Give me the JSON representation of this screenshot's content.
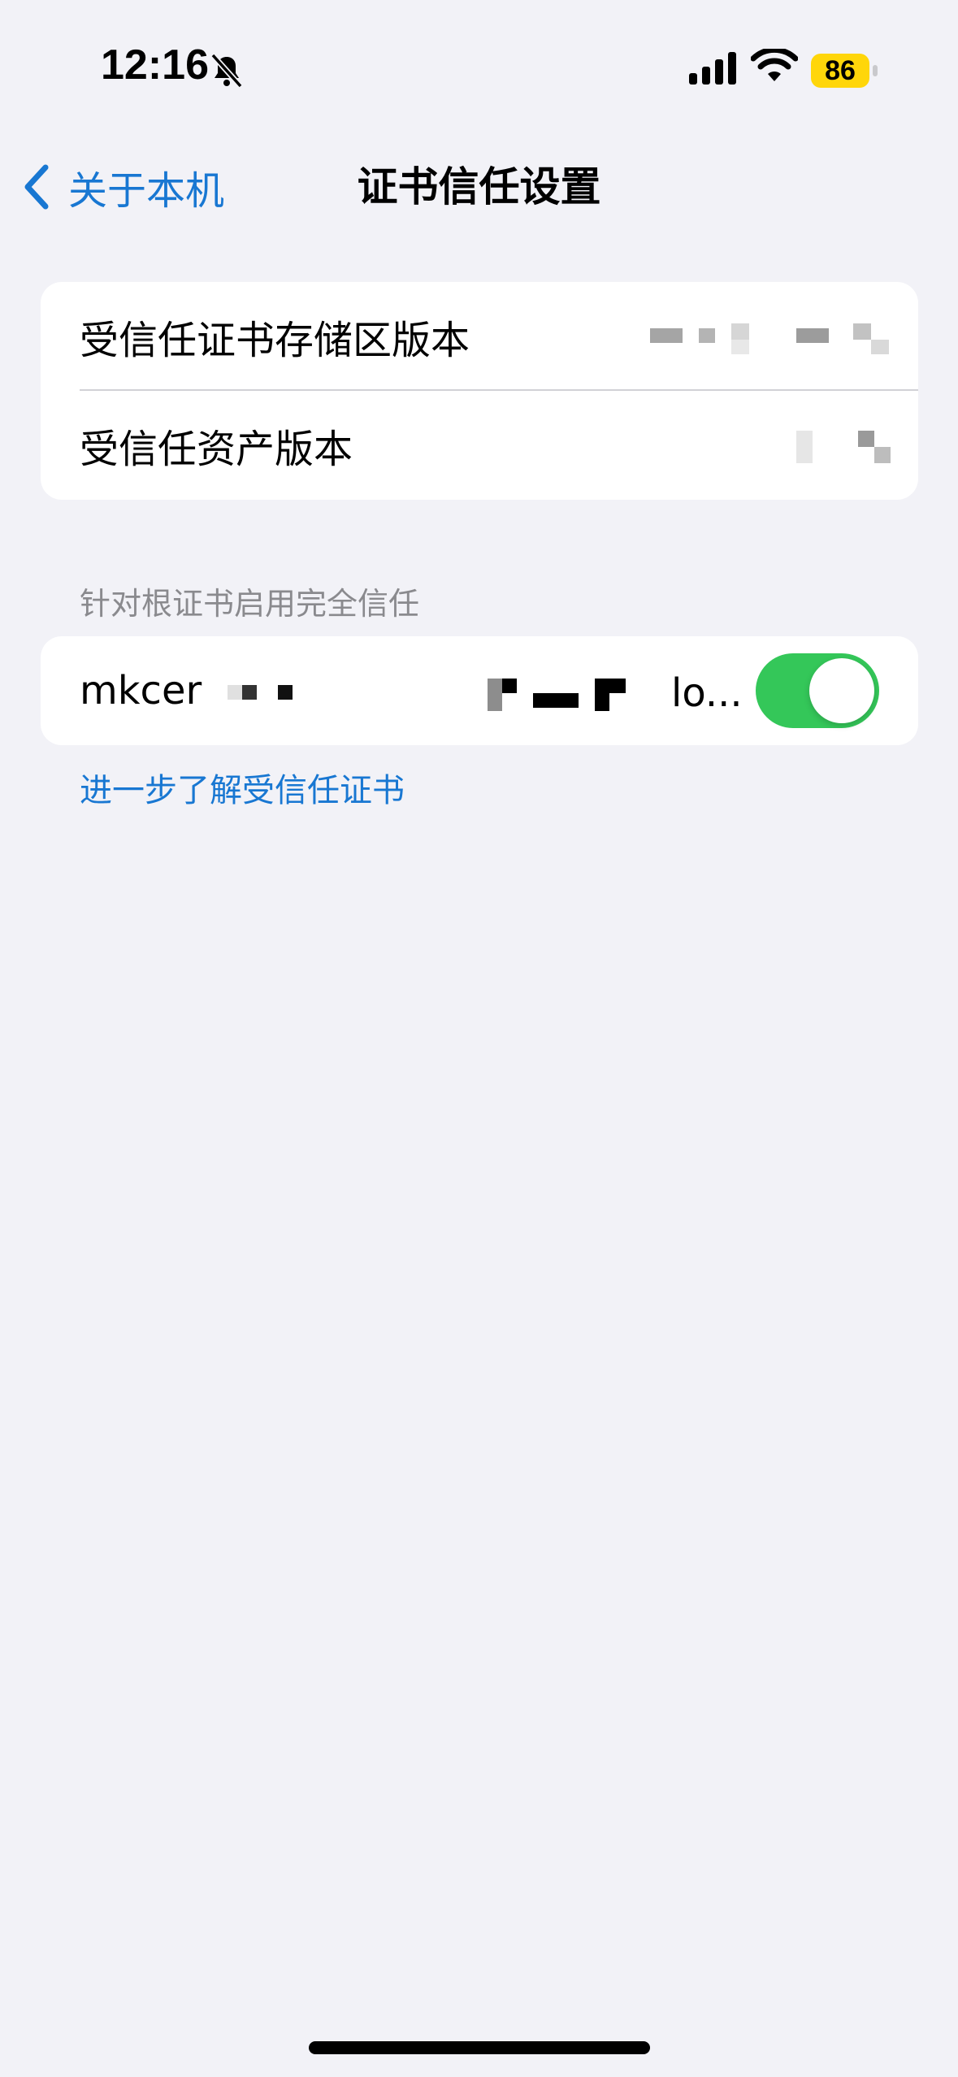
{
  "status_bar": {
    "time": "12:16",
    "battery_percent": "86",
    "battery_color": "#ffd60a",
    "icons": [
      "bell-slash-icon",
      "cellular-signal-icon",
      "wifi-icon",
      "battery-icon"
    ]
  },
  "nav": {
    "back_label": "关于本机",
    "title": "证书信任设置",
    "accent_color": "#1877d2"
  },
  "versions_group": {
    "rows": [
      {
        "label": "受信任证书存储区版本",
        "value": ""
      },
      {
        "label": "受信任资产版本",
        "value": ""
      }
    ]
  },
  "trust_section": {
    "header": "针对根证书启用完全信任",
    "certificates": [
      {
        "name_start": "mkcer",
        "name_end": "lo...",
        "enabled": true,
        "toggle_color": "#34c759"
      }
    ],
    "learn_more_link": "进一步了解受信任证书"
  }
}
